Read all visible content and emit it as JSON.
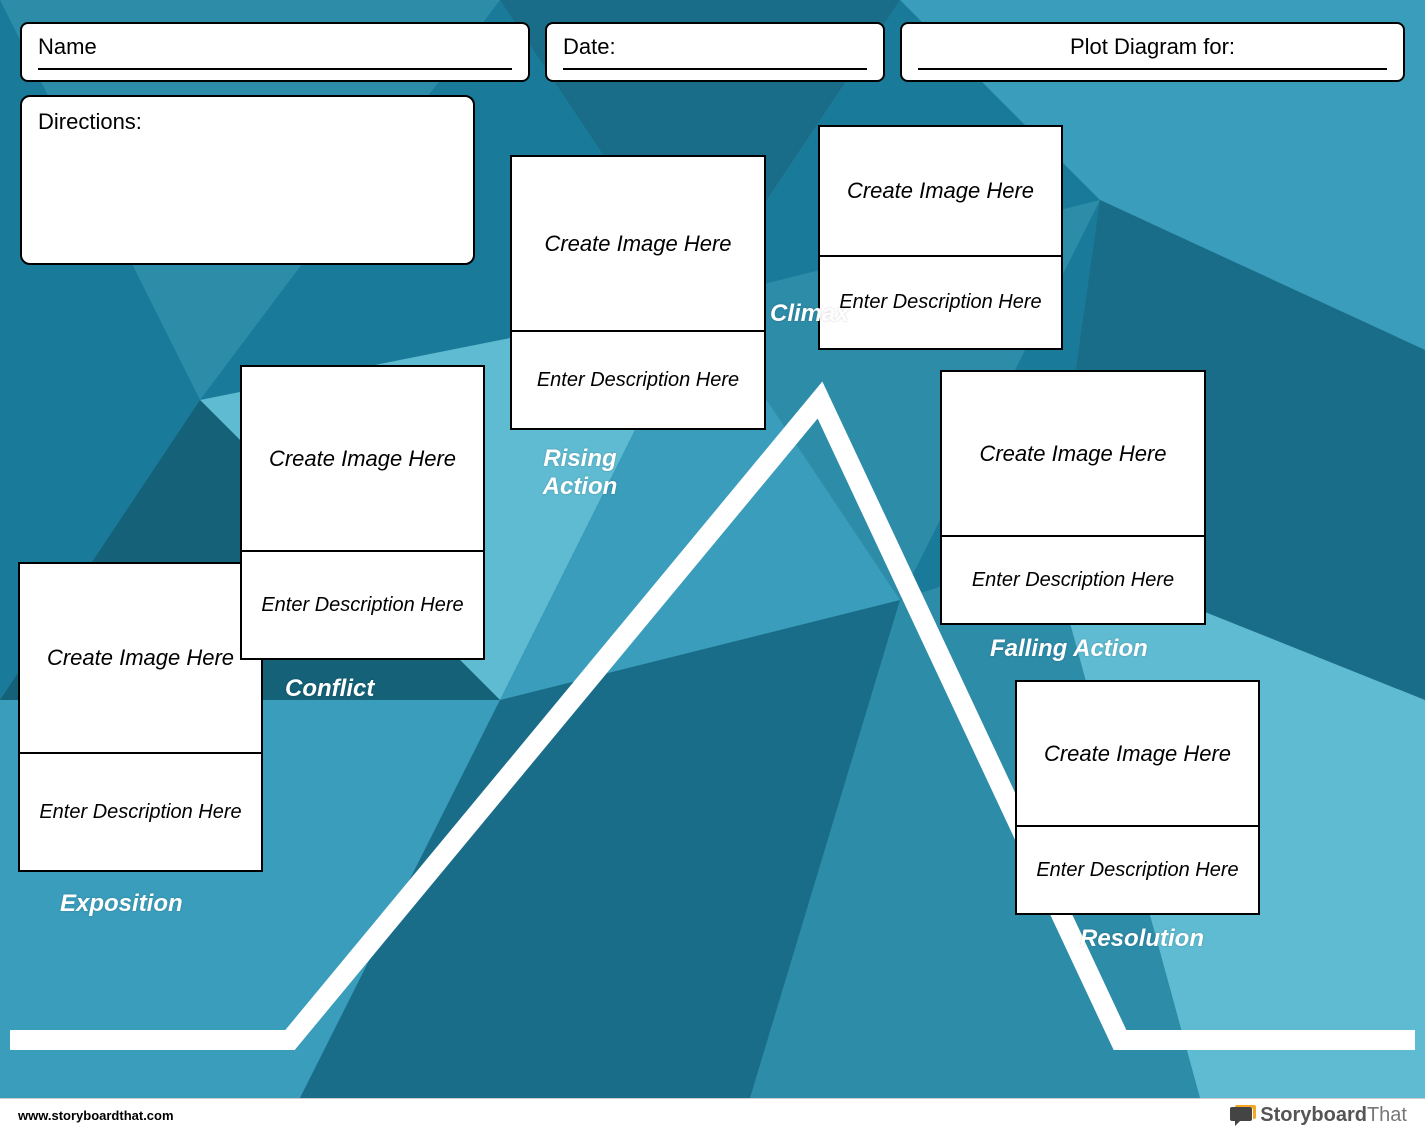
{
  "header": {
    "name_label": "Name",
    "date_label": "Date:",
    "title_label": "Plot Diagram for:"
  },
  "directions_label": "Directions:",
  "placeholders": {
    "image": "Create Image Here",
    "description": "Enter Description Here"
  },
  "stages": {
    "exposition": "Exposition",
    "conflict": "Conflict",
    "rising_action": "Rising\nAction",
    "climax": "Climax",
    "falling_action": "Falling Action",
    "resolution": "Resolution"
  },
  "footer": {
    "url": "www.storyboardthat.com",
    "brand_bold": "Storyboard",
    "brand_light": "That"
  }
}
